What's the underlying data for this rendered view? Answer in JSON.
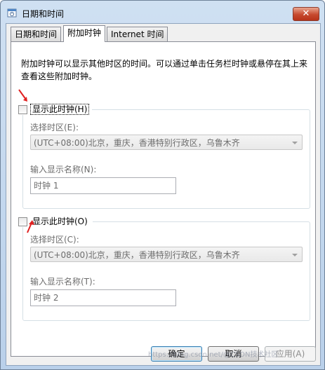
{
  "window": {
    "title": "日期和时间",
    "close_glyph": "✕"
  },
  "tabs": [
    {
      "label": "日期和时间",
      "active": false
    },
    {
      "label": "附加时钟",
      "active": true
    },
    {
      "label": "Internet 时间",
      "active": false
    }
  ],
  "description": "附加时钟可以显示其他时区的时间。可以通过单击任务栏时钟或悬停在其上来查看这些附加时钟。",
  "clock1": {
    "checkbox_label": "显示此时钟(H)",
    "checked": false,
    "timezone_label": "选择时区(E):",
    "timezone_value": "(UTC+08:00)北京，重庆，香港特别行政区，乌鲁木齐",
    "name_label": "输入显示名称(N):",
    "name_value": "时钟 1"
  },
  "clock2": {
    "checkbox_label": "显示此时钟(O)",
    "checked": false,
    "timezone_label": "选择时区(C):",
    "timezone_value": "(UTC+08:00)北京，重庆，香港特别行政区，乌鲁木齐",
    "name_label": "输入显示名称(T):",
    "name_value": "时钟 2"
  },
  "buttons": {
    "ok": "确定",
    "cancel": "取消",
    "apply": "应用(A)"
  },
  "watermark": "https://blog.csdn.net/@CSDN技术社区",
  "colors": {
    "annotation_arrow": "#e02020",
    "panel_bg": "#ffffff",
    "window_frame": "#b9d0ea"
  }
}
